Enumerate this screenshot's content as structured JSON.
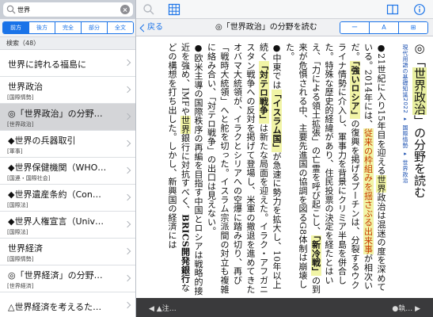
{
  "search": {
    "query": "世界"
  },
  "segments": [
    "前方",
    "後方",
    "完全",
    "部分",
    "全文"
  ],
  "results_label": "検索（48）",
  "list": [
    {
      "title": "世界に誇れる福島に",
      "sub": ""
    },
    {
      "title": "世界政治",
      "sub": "[国際情勢]"
    },
    {
      "title": "◎「世界政治」の分野…",
      "sub": "[世界政治]",
      "selected": true
    },
    {
      "title": "◆世界の兵器取引",
      "sub": "[軍事]"
    },
    {
      "title": "◆世界保健機関（WHO…",
      "sub": "[国連・国際社会]"
    },
    {
      "title": "◆世界遺産条約（Con…",
      "sub": "[国際法]"
    },
    {
      "title": "◆世界人権宣言（Univ…",
      "sub": "[国際法]"
    },
    {
      "title": "世界経済",
      "sub": "[国際情勢]"
    },
    {
      "title": "◎「世界経済」の分野…",
      "sub": "[世界経済]"
    },
    {
      "title": "△世界経済を考えるた…",
      "sub": ""
    }
  ],
  "nav": {
    "back": "戻る",
    "title": "◎「世界政治」の分野を読む"
  },
  "tools": [
    "ー",
    "A",
    "⊞"
  ],
  "article": {
    "heading_pre": "◎「",
    "heading_hl": "世界政治",
    "heading_post": "」の分野を読む",
    "crumb": "現代用語の基礎知識2022 ▸ 国際情勢 ▸ 世界政治",
    "p1_a": "●21世紀に入り15年目を迎える",
    "p1_hl": "世界",
    "p1_b": "政治は混迷の度を深めている。2014年には、",
    "p1_o": "従来の枠組みを揺さぶる出来事",
    "p1_c": "が相次いだ。",
    "p1_strong": "「強いロシア」",
    "p1_d": "の復興を掲げるプーチンは、分裂するウクライナ情勢に介入し、軍事力を背景にクリミア半島を併合した。特殊な歴史的経緯があり、住民投票の決定を経たとはいえ、「力による領土拡張」の亡霊を呼び起こし、",
    "p1_e": "「新冷戦」",
    "p1_f": "の到来が危惧される中、主要先進国の協調を図るG8体制は崩壊した。",
    "p2_a": "●中東では",
    "p2_b": "「イスラム国」",
    "p2_c": "が急速に勢力を拡大し、10年以上続く",
    "p2_d": "「対テロ戦争」",
    "p2_e": "は新たな局面を迎えた。イラク・アフガニスタン戦争への反対を掲げて登場し、米軍の撤退を進めてきたオバマ大統領が、イラクとシリアへの空爆に踏み切り、再び「戦時大統領」へと舵を切った。イスラム宗派間の対立も複雑に絡み合い、「対テロ戦争」の出口は見えない。",
    "p3_a": "●欧米主導の国際秩序の再編を目指す中国とロシアは戦略的接近を強め、IMFや",
    "p3_hl": "世界",
    "p3_b": "銀行に対抗すべく、",
    "p3_c": "BRICS開発銀行",
    "p3_d": "などの構想を打ち出した。しかし、新興国の経済には"
  },
  "bottom": {
    "left": "◀ ▲注…",
    "right": "●執… ▶"
  }
}
